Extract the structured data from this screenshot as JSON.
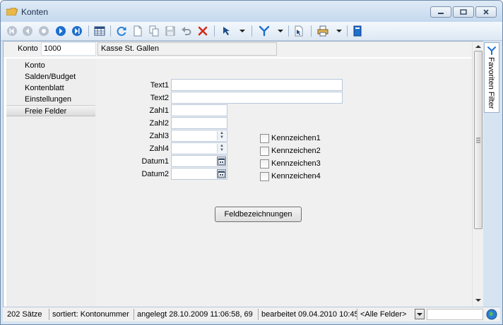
{
  "window": {
    "title": "Konten"
  },
  "header": {
    "konto_label": "Konto",
    "konto_value": "1000",
    "konto_name": "Kasse St. Gallen"
  },
  "nav": {
    "items": [
      "Konto",
      "Salden/Budget",
      "Kontenblatt",
      "Einstellungen",
      "Freie Felder"
    ],
    "selected": "Freie Felder"
  },
  "form": {
    "fields": {
      "text1": "Text1",
      "text2": "Text2",
      "zahl1": "Zahl1",
      "zahl2": "Zahl2",
      "zahl3": "Zahl3",
      "zahl4": "Zahl4",
      "datum1": "Datum1",
      "datum2": "Datum2"
    },
    "checkboxes": [
      "Kennzeichen1",
      "Kennzeichen2",
      "Kennzeichen3",
      "Kennzeichen4"
    ],
    "button_label": "Feldbezeichnungen"
  },
  "side_panel": {
    "tab_label": "Favoriten Filter"
  },
  "status": {
    "count": "202 Sätze",
    "sort": "sortiert: Kontonummer",
    "created": "angelegt 28.10.2009 11:06:58, 69",
    "edited": "bearbeitet 09.04.2010 10:45",
    "filter": "<Alle Felder>"
  },
  "colors": {
    "accent": "#1e6fce",
    "delete_red": "#d42a1a",
    "window_frame": "#d6e4f2"
  }
}
